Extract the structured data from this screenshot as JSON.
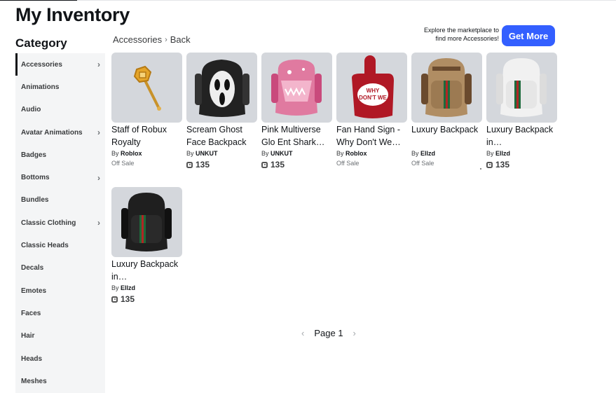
{
  "page": {
    "title": "My Inventory"
  },
  "sidebar": {
    "title": "Category",
    "items": [
      {
        "label": "Accessories",
        "chevron": true,
        "active": true
      },
      {
        "label": "Animations",
        "chevron": false
      },
      {
        "label": "Audio",
        "chevron": false
      },
      {
        "label": "Avatar Animations",
        "chevron": true
      },
      {
        "label": "Badges",
        "chevron": false
      },
      {
        "label": "Bottoms",
        "chevron": true
      },
      {
        "label": "Bundles",
        "chevron": false
      },
      {
        "label": "Classic Clothing",
        "chevron": true
      },
      {
        "label": "Classic Heads",
        "chevron": false
      },
      {
        "label": "Decals",
        "chevron": false
      },
      {
        "label": "Emotes",
        "chevron": false
      },
      {
        "label": "Faces",
        "chevron": false
      },
      {
        "label": "Hair",
        "chevron": false
      },
      {
        "label": "Heads",
        "chevron": false
      },
      {
        "label": "Meshes",
        "chevron": false
      }
    ]
  },
  "breadcrumb": {
    "current": "Accessories",
    "separator": "›",
    "back": "Back"
  },
  "promo": {
    "text": "Explore the marketplace to find more Accessories!",
    "button": "Get More"
  },
  "items": [
    {
      "name": "Staff of Robux Royalty",
      "by": "By",
      "creator": "Roblox",
      "price": "Off Sale",
      "offsale": true,
      "icon": "staff-icon"
    },
    {
      "name": "Scream Ghost Face Backpack",
      "by": "By",
      "creator": "UNKUT",
      "price": "135",
      "offsale": false,
      "icon": "ghostface-backpack-icon"
    },
    {
      "name": "Pink Multiverse Glo Ent Shark…",
      "by": "By",
      "creator": "UNKUT",
      "price": "135",
      "offsale": false,
      "icon": "pink-shark-backpack-icon"
    },
    {
      "name": "Fan Hand Sign - Why Don't We…",
      "by": "By",
      "creator": "Roblox",
      "price": "Off Sale",
      "offsale": true,
      "icon": "foam-finger-icon"
    },
    {
      "name": "Luxury Backpack",
      "by": "By",
      "creator": "Ellzd",
      "price": "Off Sale",
      "offsale": true,
      "icon": "tan-backpack-icon"
    },
    {
      "name": "Luxury Backpack in…",
      "by": "By",
      "creator": "Ellzd",
      "price": "135",
      "offsale": false,
      "icon": "white-backpack-icon"
    },
    {
      "name": "Luxury Backpack in…",
      "by": "By",
      "creator": "Ellzd",
      "price": "135",
      "offsale": false,
      "icon": "black-backpack-icon"
    }
  ],
  "pagination": {
    "label": "Page 1",
    "prev": "‹",
    "next": "›"
  },
  "colors": {
    "accent": "#335fff",
    "thumb_bg": "#d4d7dc",
    "sidebar_bg": "#f4f5f6"
  }
}
